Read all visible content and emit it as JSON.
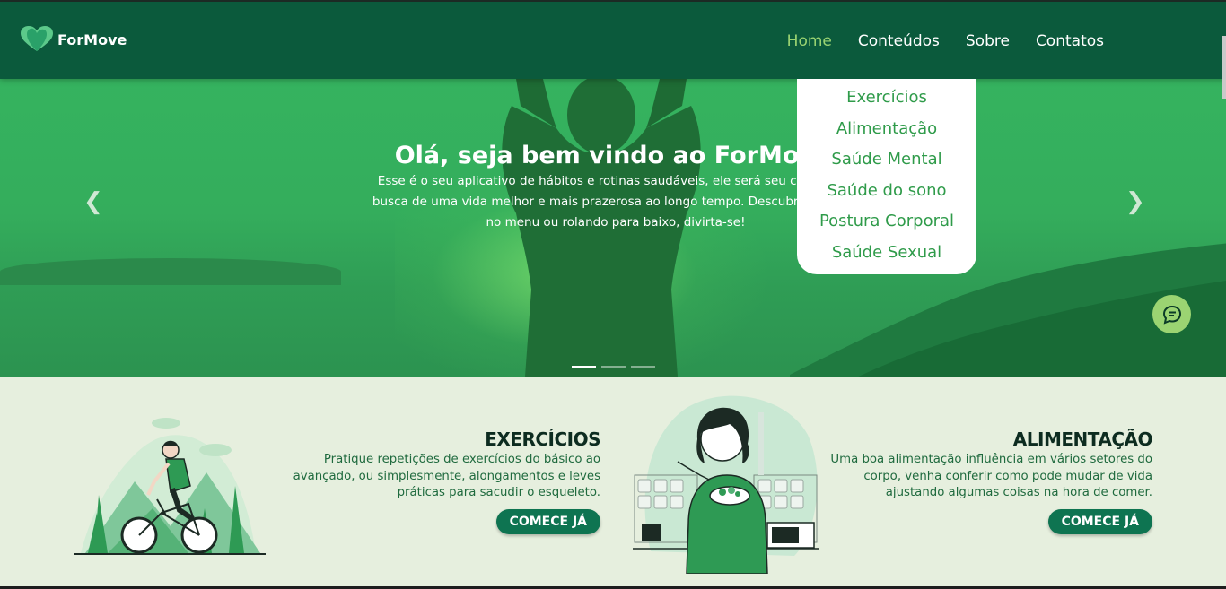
{
  "brand": {
    "name": "ForMove",
    "logo_icon": "heart-logo-icon",
    "color": "#0b5a3c",
    "accent": "#9bd472"
  },
  "nav": {
    "items": [
      {
        "label": "Home",
        "active": true
      },
      {
        "label": "Conteúdos",
        "active": false
      },
      {
        "label": "Sobre",
        "active": false
      },
      {
        "label": "Contatos",
        "active": false
      }
    ]
  },
  "dropdown": {
    "items": [
      "Exercícios",
      "Alimentação",
      "Saúde Mental",
      "Saúde do sono",
      "Postura Corporal",
      "Saúde Sexual"
    ]
  },
  "hero": {
    "title": "Olá, seja bem vindo ao ForMove",
    "text_line1": "Esse é o seu aplicativo de hábitos e rotinas saudáveis, ele será seu companhe",
    "text_line2": "busca de uma vida melhor e mais prazerosa ao longo tempo. Descubra todas fu",
    "text_line3": "no menu ou rolando para baixo, divirta-se!",
    "prev_icon": "chevron-left-icon",
    "next_icon": "chevron-right-icon",
    "slides_total": 3,
    "active_slide": 1,
    "chat_icon": "chat-icon"
  },
  "sections": [
    {
      "title": "EXERCÍCIOS",
      "line1": "Pratique repetições de exercícios do básico ao",
      "line2": "avançado, ou simplesmente, alongamentos e leves",
      "line3": "práticas para sacudir o esqueleto.",
      "button": "COMECE JÁ",
      "illustration": "cyclist-illustration"
    },
    {
      "title": "ALIMENTAÇÃO",
      "line1": "Uma boa alimentação influência em vários setores do",
      "line2": "corpo, venha conferir como pode mudar de vida",
      "line3": "ajustando algumas coisas na hora de comer.",
      "button": "COMECE JÁ",
      "illustration": "woman-eating-salad-illustration"
    }
  ]
}
